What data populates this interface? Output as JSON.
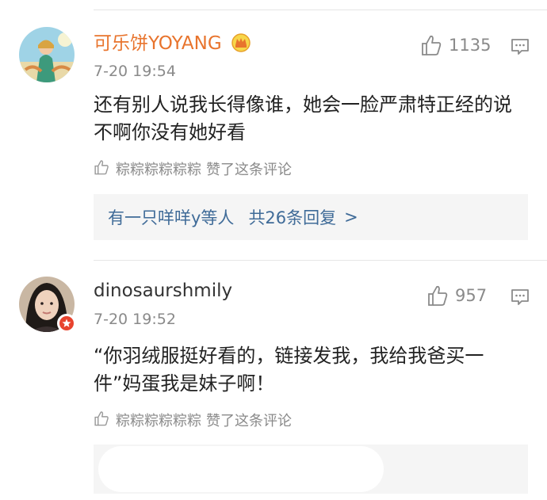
{
  "comments": [
    {
      "username": "可乐饼YOYANG",
      "time": "7-20 19:54",
      "like_count": "1135",
      "content": "还有别人说我长得像谁，她会一脸严肃特正经的说不啊你没有她好看",
      "liked_by_name": "粽粽粽粽粽粽",
      "liked_by_suffix": "赞了这条评论",
      "reply_preview": {
        "from": "有一只咩咩y等人",
        "count_text": "共26条回复",
        "chevron": ">"
      },
      "username_color": "#e8742d",
      "badge_icon": "crown-icon"
    },
    {
      "username": "dinosaurshmily",
      "time": "7-20 19:52",
      "like_count": "957",
      "content": "“你羽绒服挺好看的，链接发我，我给我爸买一件”妈蛋我是妹子啊！",
      "liked_by_name": "粽粽粽粽粽粽",
      "liked_by_suffix": "赞了这条评论",
      "username_color": "#333333",
      "badge_icon": "star-badge-icon"
    }
  ],
  "colors": {
    "link_blue": "#3f6b98",
    "meta_gray": "#8a8a8a",
    "divider": "#e6e6e6"
  }
}
